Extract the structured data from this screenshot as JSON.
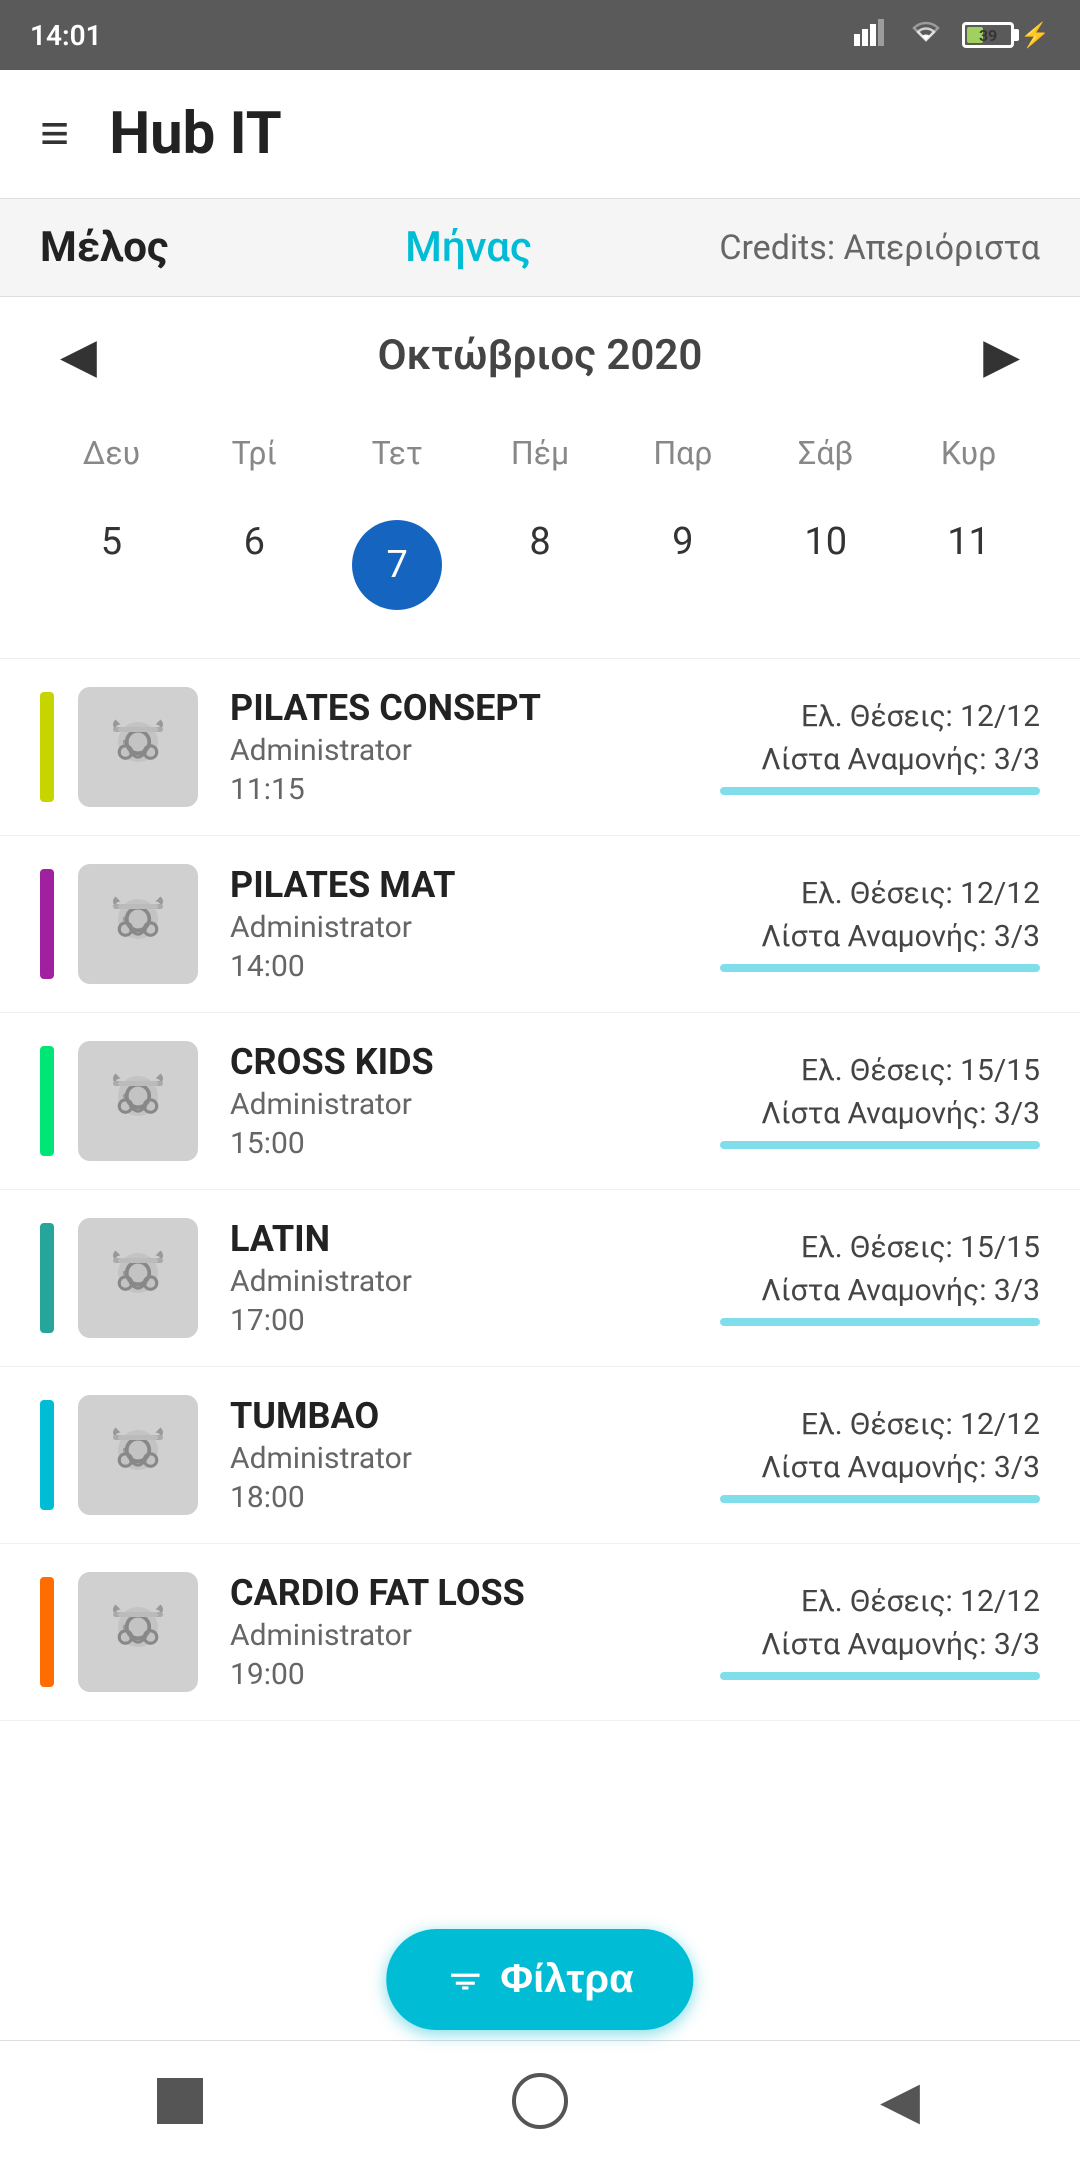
{
  "statusBar": {
    "time": "14:01",
    "battery": "39"
  },
  "header": {
    "title": "Hub IT",
    "hamburger": "≡"
  },
  "subHeader": {
    "melos": "Μέλος",
    "minas": "Μήνας",
    "credits": "Credits: Απεριόριστα"
  },
  "calendar": {
    "prevArrow": "◀",
    "nextArrow": "▶",
    "monthLabel": "Οκτώβριος 2020",
    "weekdays": [
      "Δευ",
      "Τρί",
      "Τετ",
      "Πέμ",
      "Παρ",
      "Σάβ",
      "Κυρ"
    ],
    "dates": [
      5,
      6,
      7,
      8,
      9,
      10,
      11
    ],
    "selectedDate": 7
  },
  "classes": [
    {
      "id": 1,
      "color": "#c6d400",
      "name": "PILATES CONSEPT",
      "admin": "Administrator",
      "time": "11:15",
      "available": "Ελ. Θέσεις: 12/12",
      "waiting": "Λίστα Αναμονής: 3/3"
    },
    {
      "id": 2,
      "color": "#a020a0",
      "name": "PILATES MAT",
      "admin": "Administrator",
      "time": "14:00",
      "available": "Ελ. Θέσεις: 12/12",
      "waiting": "Λίστα Αναμονής: 3/3"
    },
    {
      "id": 3,
      "color": "#00e676",
      "name": "CROSS KIDS",
      "admin": "Administrator",
      "time": "15:00",
      "available": "Ελ. Θέσεις: 15/15",
      "waiting": "Λίστα Αναμονής: 3/3"
    },
    {
      "id": 4,
      "color": "#26a69a",
      "name": "LATIN",
      "admin": "Administrator",
      "time": "17:00",
      "available": "Ελ. Θέσεις: 15/15",
      "waiting": "Λίστα Αναμονής: 3/3"
    },
    {
      "id": 5,
      "color": "#00bcd4",
      "name": "TUMBAO",
      "admin": "Administrator",
      "time": "18:00",
      "available": "Ελ. Θέσεις: 12/12",
      "waiting": "Λίστα Αναμονής: 3/3"
    },
    {
      "id": 6,
      "color": "#ff6d00",
      "name": "CARDIO FAT LOSS",
      "admin": "Administrator",
      "time": "19:00",
      "available": "Ελ. Θέσεις: 12/12",
      "waiting": "Λίστα Αναμονής: 3/3"
    }
  ],
  "filterButton": {
    "label": "Φίλτρα"
  },
  "bottomNav": {
    "stop": "stop",
    "home": "home",
    "back": "back"
  }
}
